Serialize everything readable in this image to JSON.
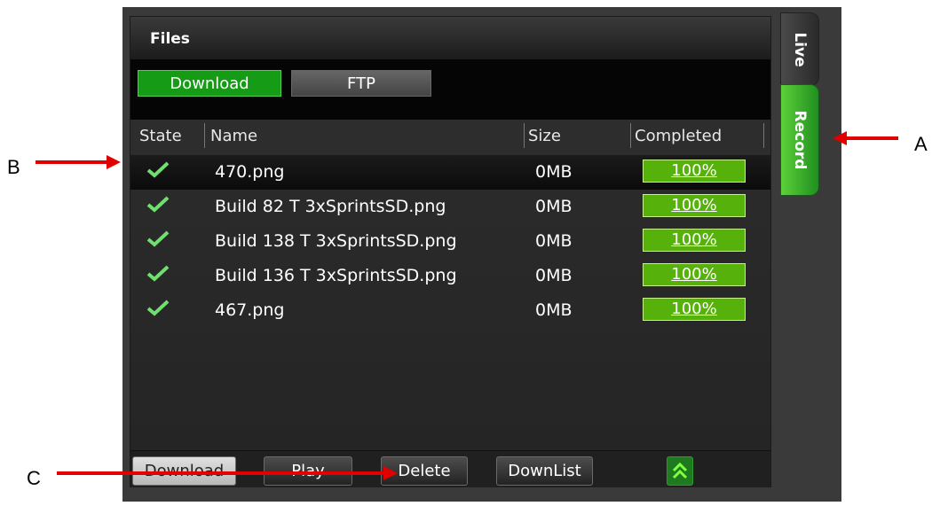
{
  "panel": {
    "title": "Files"
  },
  "tabs": [
    {
      "label": "Download",
      "active": true
    },
    {
      "label": "FTP",
      "active": false
    }
  ],
  "columns": [
    "State",
    "Name",
    "Size",
    "Completed"
  ],
  "rows": [
    {
      "state": "check",
      "name": "470.png",
      "size": "0MB",
      "completed": "100%",
      "selected": true
    },
    {
      "state": "check",
      "name": "Build 82 T 3xSprintsSD.png",
      "size": "0MB",
      "completed": "100%"
    },
    {
      "state": "check",
      "name": "Build 138 T 3xSprintsSD.png",
      "size": "0MB",
      "completed": "100%"
    },
    {
      "state": "check",
      "name": "Build 136 T 3xSprintsSD.png",
      "size": "0MB",
      "completed": "100%"
    },
    {
      "state": "check",
      "name": "467.png",
      "size": "0MB",
      "completed": "100%"
    }
  ],
  "footer": {
    "download": "Download",
    "play": "Play",
    "delete": "Delete",
    "downlist": "DownList",
    "up_icon": "double-chevron-up-icon"
  },
  "side_tabs": {
    "live": "Live",
    "record": "Record"
  },
  "annotations": {
    "a": "A",
    "b": "B",
    "c": "C"
  },
  "colors": {
    "accent_green": "#57b10b",
    "arrow_red": "#e00000"
  }
}
